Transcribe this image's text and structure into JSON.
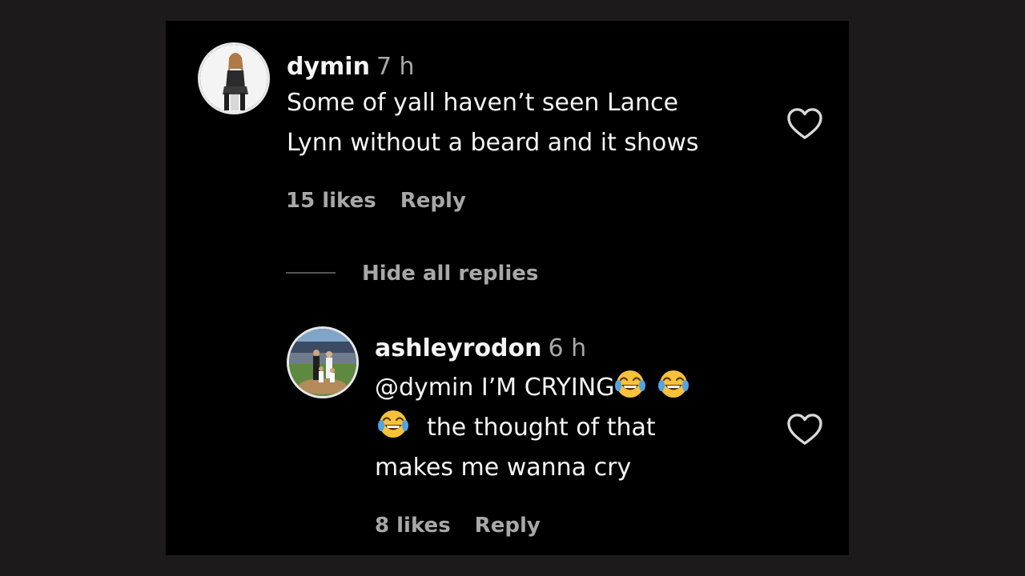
{
  "comment": {
    "username": "dymin",
    "time": "7 h",
    "text_lines": [
      "Some of yall haven’t seen Lance",
      "Lynn without a beard and it shows"
    ],
    "likes": "15 likes",
    "reply_label": "Reply"
  },
  "replies_toggle": {
    "label": "Hide all replies"
  },
  "reply": {
    "username": "ashleyrodon",
    "time": "6 h",
    "line1_text": "@dymin I’M CRYING",
    "line2_text": "the thought of that",
    "line3_text": "makes me wanna cry",
    "emoji": "face-with-tears-of-joy",
    "likes": "8 likes",
    "reply_label": "Reply"
  },
  "colors": {
    "background": "#000000",
    "outer_background": "#1c1a1a",
    "primary_text": "#f5f5f5",
    "secondary_text": "#a8a8a8"
  },
  "icons": {
    "like": "heart-outline-icon"
  }
}
